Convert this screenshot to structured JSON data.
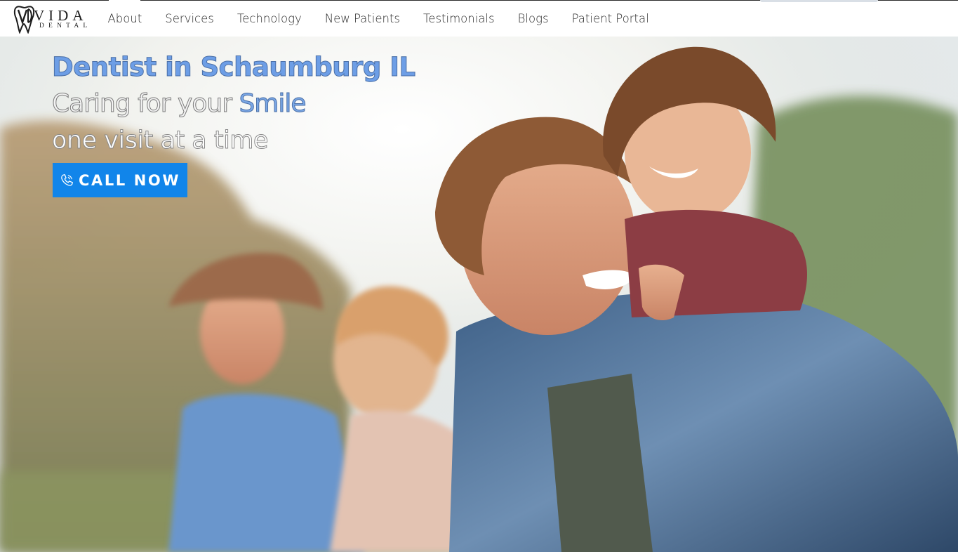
{
  "brand": {
    "name": "VIDA",
    "subtitle": "DENTAL",
    "logo_icon": "tooth-monogram-icon"
  },
  "nav": {
    "items": [
      {
        "label": "About"
      },
      {
        "label": "Services"
      },
      {
        "label": "Technology"
      },
      {
        "label": "New Patients"
      },
      {
        "label": "Testimonials"
      },
      {
        "label": "Blogs"
      },
      {
        "label": "Patient Portal"
      }
    ]
  },
  "hero": {
    "headline": "Dentist in Schaumburg IL",
    "tagline_part1": "Caring for your ",
    "tagline_accent": "Smile",
    "tagline_line2": "one visit at a time",
    "cta_label": "CALL NOW",
    "cta_icon": "phone-icon",
    "image_description_icon": "family-photo",
    "colors": {
      "accent_blue": "#6d9ee6",
      "cta_blue": "#1185ea"
    }
  }
}
